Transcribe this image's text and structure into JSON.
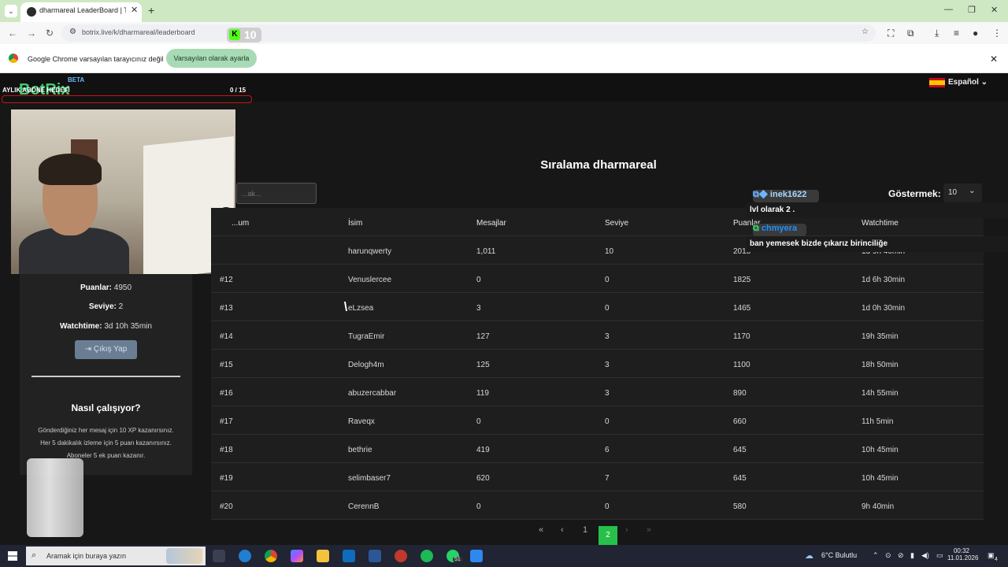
{
  "browser": {
    "tab_title": "dharmareal LeaderBoard | The I...",
    "new_tab": "+",
    "url": "botrix.live/k/dharmareal/leaderboard",
    "extension_badge": "10",
    "infobar_text": "Google Chrome varsayılan tarayıcınız değil",
    "infobar_button": "Varsayılan olarak ayarla"
  },
  "overlay": {
    "title": "AYLIK ABONE HEDEFİ",
    "count": "0 / 15"
  },
  "header": {
    "logo": "BotRix",
    "beta": "BETA",
    "language": "Español"
  },
  "profile": {
    "points_label": "Puanlar:",
    "points_value": "4950",
    "level_label": "Seviye:",
    "level_value": "2",
    "watchtime_label": "Watchtime:",
    "watchtime_value": "3d 10h 35min",
    "logout": "Çıkış Yap",
    "how_title": "Nasıl çalışıyor?",
    "how_lines": [
      "Gönderdiğiniz her mesaj için 10 XP kazanırsınız.",
      "Her 5 dakikalık izleme için 5 puan kazanırsınız.",
      "Aboneler 5 ek puan kazanır."
    ]
  },
  "main": {
    "title": "Sıralama dharmareal",
    "search_placeholder": "...ak...",
    "show_label": "Göstermek:",
    "show_value": "10",
    "columns": [
      "...um",
      "İsim",
      "Mesajlar",
      "Seviye",
      "Puanlar",
      "Watchtime"
    ],
    "rows": [
      {
        "rank": "",
        "name": "harunqwerty",
        "messages": "1,011",
        "level": "10",
        "points": "2015",
        "watchtime": "1d 9h 40min"
      },
      {
        "rank": "#12",
        "name": "Venuslercee",
        "messages": "0",
        "level": "0",
        "points": "1825",
        "watchtime": "1d 6h 30min"
      },
      {
        "rank": "#13",
        "name": "eLzsea",
        "messages": "3",
        "level": "0",
        "points": "1465",
        "watchtime": "1d 0h 30min"
      },
      {
        "rank": "#14",
        "name": "TugraEmir",
        "messages": "127",
        "level": "3",
        "points": "1170",
        "watchtime": "19h 35min"
      },
      {
        "rank": "#15",
        "name": "Delogh4m",
        "messages": "125",
        "level": "3",
        "points": "1100",
        "watchtime": "18h 50min"
      },
      {
        "rank": "#16",
        "name": "abuzercabbar",
        "messages": "119",
        "level": "3",
        "points": "890",
        "watchtime": "14h 55min"
      },
      {
        "rank": "#17",
        "name": "Raveqx",
        "messages": "0",
        "level": "0",
        "points": "660",
        "watchtime": "11h 5min"
      },
      {
        "rank": "#18",
        "name": "bethrie",
        "messages": "419",
        "level": "6",
        "points": "645",
        "watchtime": "10h 45min"
      },
      {
        "rank": "#19",
        "name": "selimbaser7",
        "messages": "620",
        "level": "7",
        "points": "645",
        "watchtime": "10h 45min"
      },
      {
        "rank": "#20",
        "name": "CerennB",
        "messages": "0",
        "level": "0",
        "points": "580",
        "watchtime": "9h 40min"
      }
    ],
    "pagination": {
      "first": "«",
      "prev": "‹",
      "page1": "1",
      "page2": "2",
      "next": "›",
      "last": "»"
    }
  },
  "chat": [
    {
      "user": "inek1622",
      "message": "lvl olarak 2 ."
    },
    {
      "user": "chmyera",
      "message": "ban yemesek bizde çıkarız birinciliğe"
    }
  ],
  "taskbar": {
    "search_placeholder": "Aramak için buraya yazın",
    "weather": "6°C Bulutlu",
    "time": "00:32",
    "date": "11.01.2026",
    "whatsapp_badge": "51",
    "notif_badge": "4"
  },
  "colors": {
    "accent_green": "#26c04a",
    "kick_green": "#53fc18",
    "chat_user_inek": "#a8d8ff",
    "chat_user_chmyera": "#1e90ff"
  }
}
